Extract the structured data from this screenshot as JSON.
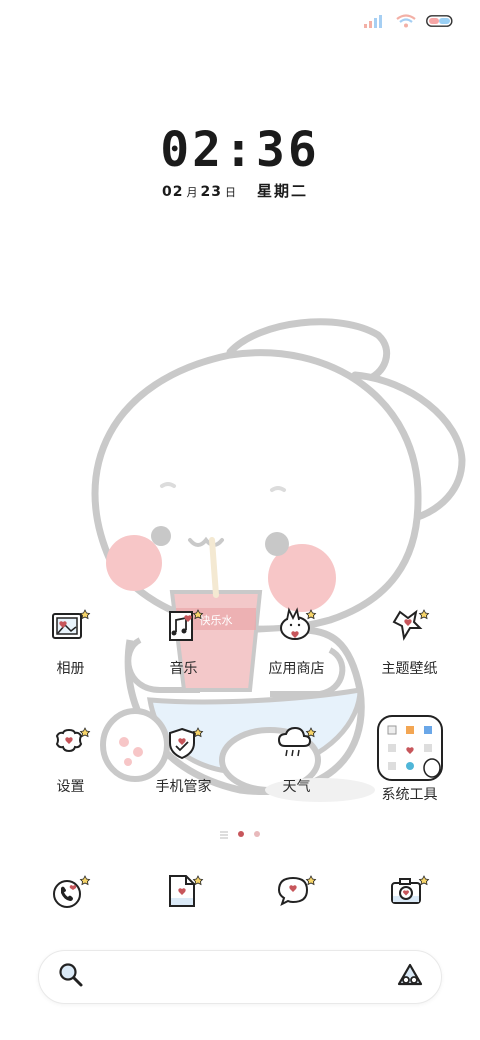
{
  "status_bar": {
    "signal_icon": "signal-bars-icon",
    "wifi_icon": "wifi-icon",
    "battery_icon": "battery-icon",
    "battery_colors": [
      "#f6a6a6",
      "#9ad0f5"
    ]
  },
  "clock": {
    "time": "02:36",
    "month": "02",
    "month_unit": "月",
    "day": "23",
    "day_unit": "日",
    "weekday": "星期二"
  },
  "apps": [
    {
      "label": "相册",
      "icon": "photo-album-icon"
    },
    {
      "label": "音乐",
      "icon": "music-note-icon"
    },
    {
      "label": "应用商店",
      "icon": "app-store-bag-icon"
    },
    {
      "label": "主题壁纸",
      "icon": "theme-brush-icon"
    },
    {
      "label": "设置",
      "icon": "settings-gear-icon"
    },
    {
      "label": "手机管家",
      "icon": "security-shield-icon"
    },
    {
      "label": "天气",
      "icon": "weather-cloud-icon"
    },
    {
      "label": "系统工具",
      "icon": "tools-folder-icon"
    }
  ],
  "page_indicator": {
    "pages": 2,
    "active_page": 1
  },
  "dock": [
    {
      "icon": "phone-icon"
    },
    {
      "icon": "notes-file-icon"
    },
    {
      "icon": "message-bubble-icon"
    },
    {
      "icon": "camera-icon"
    }
  ],
  "search": {
    "placeholder": "",
    "search_icon": "search-icon",
    "assistant_icon": "assistant-icon"
  },
  "wallpaper": {
    "subject": "bunny-with-drink",
    "cup_text": "快乐水",
    "accent_pink": "#f7c6c7",
    "heart_red": "#c7565b",
    "line_gray": "#c9c9c9"
  }
}
